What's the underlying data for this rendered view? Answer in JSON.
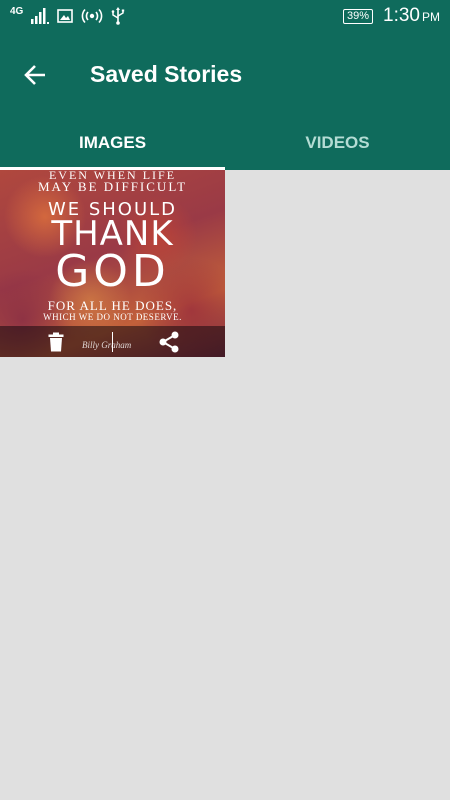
{
  "status_bar": {
    "network": "4G",
    "battery": "39%",
    "time": "1:30",
    "ampm": "PM"
  },
  "app_bar": {
    "title": "Saved Stories",
    "back_icon": "arrow-left-icon"
  },
  "tabs": [
    {
      "label": "IMAGES",
      "selected": true
    },
    {
      "label": "VIDEOS",
      "selected": false
    }
  ],
  "gallery": {
    "items": [
      {
        "quote_lines": [
          "EVEN WHEN LIFE",
          "MAY BE DIFFICULT",
          "WE SHOULD",
          "THANK",
          "GOD",
          "FOR ALL HE DOES,",
          "WHICH WE DO NOT DESERVE."
        ],
        "signature": "Billy Graham",
        "actions": [
          "delete-icon",
          "share-icon"
        ]
      }
    ]
  },
  "colors": {
    "primary": "#0f6b5c",
    "tab_active": "#ffffff",
    "tab_inactive": "#b4dcd4",
    "background": "#e0e0e0"
  }
}
